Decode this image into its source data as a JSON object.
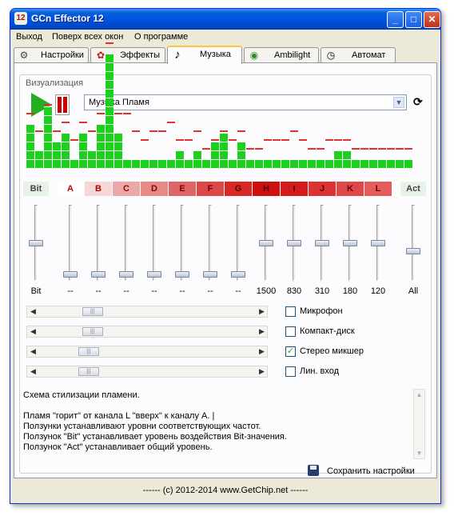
{
  "window": {
    "title": "GCn Effector 12",
    "app_icon_text": "12",
    "btn_minimize": "_",
    "btn_maximize": "□",
    "btn_close": "✕"
  },
  "menu": [
    "Выход",
    "Поверх всех окон",
    "О программе"
  ],
  "tabs": [
    {
      "label": "Настройки",
      "icon": "gear-icon",
      "glyph": "⚙"
    },
    {
      "label": "Эффекты",
      "icon": "butterfly-icon",
      "glyph": "✿"
    },
    {
      "label": "Музыка",
      "icon": "music-note-icon",
      "glyph": "♪"
    },
    {
      "label": "Ambilight",
      "icon": "eye-icon",
      "glyph": "◉"
    },
    {
      "label": "Автомат",
      "icon": "clock-icon",
      "glyph": "◷"
    }
  ],
  "active_tab": "Музыка",
  "group_label": "Визуализация",
  "preset": {
    "value": "Музыка Пламя",
    "arrow": "▼"
  },
  "refresh_glyph": "⟳",
  "spectrum": {
    "bar_color": "#1ed01e",
    "peak_color": "#e03030",
    "levels": [
      5,
      2,
      7,
      3,
      4,
      1,
      4,
      2,
      5,
      13,
      4,
      1,
      1,
      1,
      1,
      1,
      1,
      2,
      1,
      2,
      1,
      3,
      4,
      1,
      3,
      1,
      1,
      1,
      1,
      1,
      1,
      1,
      1,
      1,
      1,
      2,
      2,
      1,
      1,
      1,
      1,
      1,
      1,
      1
    ],
    "peaks": [
      6,
      4,
      7,
      4,
      5,
      3,
      5,
      4,
      6,
      14,
      6,
      6,
      4,
      3,
      4,
      4,
      5,
      3,
      3,
      4,
      2,
      3,
      4,
      3,
      4,
      2,
      2,
      3,
      3,
      3,
      4,
      3,
      2,
      2,
      3,
      3,
      3,
      2,
      2,
      2,
      2,
      2,
      2,
      2
    ]
  },
  "channels": [
    {
      "key": "bit",
      "label": "Bit",
      "bg": "#e6f3e6",
      "color": "#444"
    },
    {
      "key": "a",
      "label": "A",
      "bg": "#ffffff",
      "color": "#c00000"
    },
    {
      "key": "b",
      "label": "B",
      "bg": "#f6d6d6",
      "color": "#b00000"
    },
    {
      "key": "c",
      "label": "C",
      "bg": "#eca8a8",
      "color": "#a00000"
    },
    {
      "key": "d",
      "label": "D",
      "bg": "#e68a8a",
      "color": "#900000"
    },
    {
      "key": "e",
      "label": "E",
      "bg": "#e06666",
      "color": "#800000"
    },
    {
      "key": "f",
      "label": "F",
      "bg": "#dc4848",
      "color": "#700000"
    },
    {
      "key": "g",
      "label": "G",
      "bg": "#d82828",
      "color": "#600000"
    },
    {
      "key": "h",
      "label": "H",
      "bg": "#cc1010",
      "color": "#500000"
    },
    {
      "key": "i",
      "label": "I",
      "bg": "#d41a1a",
      "color": "#500000"
    },
    {
      "key": "j",
      "label": "J",
      "bg": "#dc3434",
      "color": "#600000"
    },
    {
      "key": "k",
      "label": "K",
      "bg": "#e04848",
      "color": "#600000"
    },
    {
      "key": "l",
      "label": "L",
      "bg": "#e45c5c",
      "color": "#600000"
    },
    {
      "key": "act",
      "label": "Act",
      "bg": "#e6f3e6",
      "color": "#444"
    }
  ],
  "sliders": [
    {
      "label": "Bit",
      "level": 0.5
    },
    {
      "label": "--",
      "level": 0.05
    },
    {
      "label": "--",
      "level": 0.05
    },
    {
      "label": "--",
      "level": 0.05
    },
    {
      "label": "--",
      "level": 0.05
    },
    {
      "label": "--",
      "level": 0.05
    },
    {
      "label": "--",
      "level": 0.05
    },
    {
      "label": "--",
      "level": 0.05
    },
    {
      "label": "1500",
      "level": 0.5
    },
    {
      "label": "830",
      "level": 0.5
    },
    {
      "label": "310",
      "level": 0.5
    },
    {
      "label": "180",
      "level": 0.5
    },
    {
      "label": "120",
      "level": 0.5
    },
    {
      "label": "All",
      "level": 0.38
    }
  ],
  "scroll_arrows": {
    "left": "◀",
    "right": "▶",
    "up": "▲",
    "down": "▼",
    "grip": "|||"
  },
  "inputs": [
    {
      "label": "Микрофон",
      "checked": false,
      "level": 0.22
    },
    {
      "label": "Компакт-диск",
      "checked": false,
      "level": 0.22
    },
    {
      "label": "Стерео микшер",
      "checked": true,
      "level": 0.2
    },
    {
      "label": "Лин. вход",
      "checked": false,
      "level": 0.2
    }
  ],
  "check_mark": "✓",
  "description": [
    "Схема стилизации пламени.",
    "",
    "Пламя \"горит\" от канала L \"вверх\" к каналу А. |",
    "Ползунки устанавливают уровни соответствующих частот.",
    "Ползунок \"Bit\" устанавливает уровень воздействия Bit-значения.",
    "Ползунок \"Act\" устанавливает общий уровень."
  ],
  "save_label": "Сохранить настройки",
  "footer": "------  (c) 2012-2014  www.GetChip.net  ------"
}
